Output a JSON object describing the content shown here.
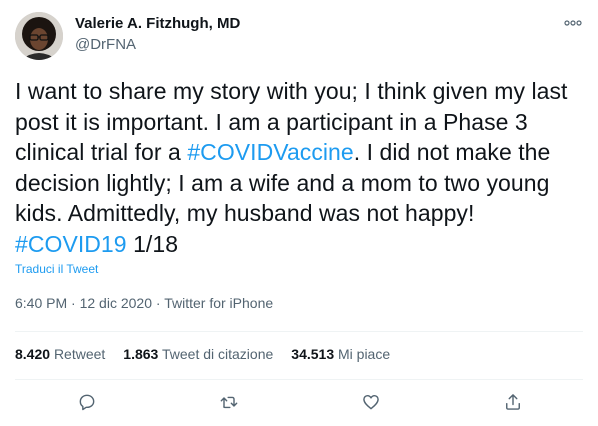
{
  "author": {
    "name": "Valerie A. Fitzhugh, MD",
    "handle": "@DrFNA"
  },
  "tweet": {
    "segments": [
      {
        "text": "I want to share my story with you; I think given my last post it is important. I am a participant in a Phase 3 clinical trial for a ",
        "type": "text"
      },
      {
        "text": "#COVIDVaccine",
        "type": "hashtag"
      },
      {
        "text": ". I did not make the decision lightly; I am a wife and a mom to two young kids. Admittedly, my husband was not happy! ",
        "type": "text"
      },
      {
        "text": "#COVID19",
        "type": "hashtag"
      },
      {
        "text": " 1/18",
        "type": "text"
      }
    ],
    "translate_label": "Traduci il Tweet"
  },
  "meta": {
    "time": "6:40 PM",
    "separator": " · ",
    "date": "12 dic 2020",
    "source": "Twitter for iPhone"
  },
  "stats": {
    "retweets": {
      "count": "8.420",
      "label": "Retweet"
    },
    "quotes": {
      "count": "1.863",
      "label": "Tweet di citazione"
    },
    "likes": {
      "count": "34.513",
      "label": "Mi piace"
    }
  },
  "colors": {
    "accent": "#1d9bf0",
    "secondary_text": "#536471",
    "divider": "#eff3f4"
  },
  "icons": [
    "more-icon",
    "reply-icon",
    "retweet-icon",
    "like-icon",
    "share-icon"
  ]
}
